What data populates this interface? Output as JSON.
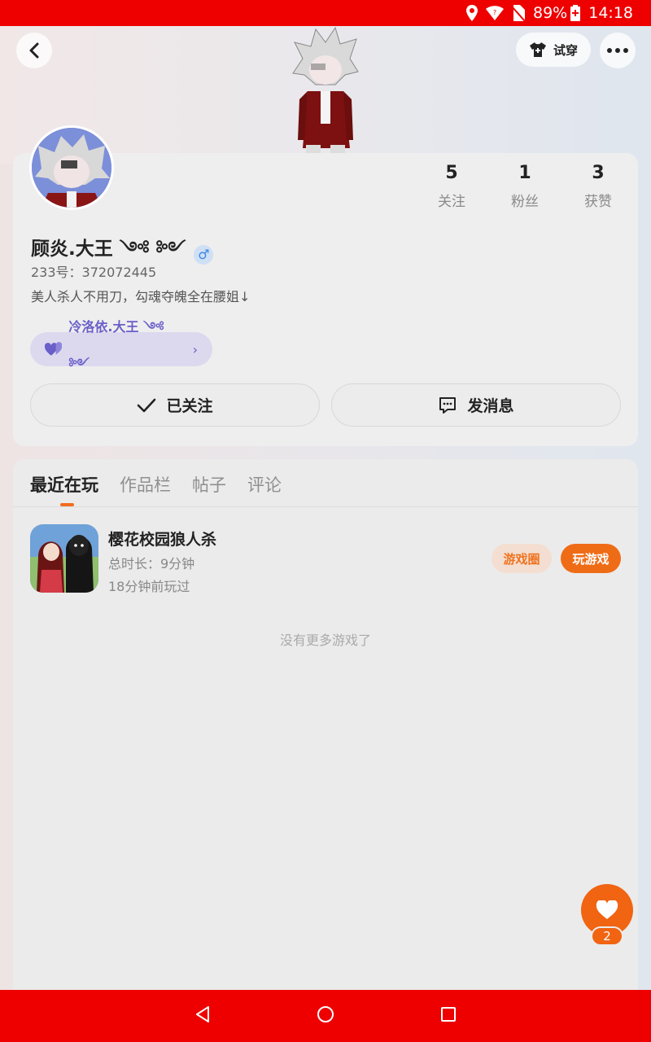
{
  "status_bar": {
    "battery": "89%",
    "time": "14:18"
  },
  "header": {
    "try_on_label": "试穿"
  },
  "profile": {
    "username": "顾炎.大王 ༺ ༻",
    "gender_symbol": "♂",
    "uid": "233号：372072445",
    "bio": "美人杀人不用刀，勾魂夺魄全在腰姐↓",
    "stats": [
      {
        "value": "5",
        "label": "关注"
      },
      {
        "value": "1",
        "label": "粉丝"
      },
      {
        "value": "3",
        "label": "获赞"
      }
    ],
    "cp_tag": {
      "name": "冷洛依.大王 ༺ ༻",
      "chevron": "›"
    },
    "follow_button": "已关注",
    "message_button": "发消息"
  },
  "tabs": [
    {
      "label": "最近在玩",
      "active": true
    },
    {
      "label": "作品栏",
      "active": false
    },
    {
      "label": "帖子",
      "active": false
    },
    {
      "label": "评论",
      "active": false
    }
  ],
  "games": [
    {
      "title": "樱花校园狼人杀",
      "duration": "总时长：9分钟",
      "last_played": "18分钟前玩过",
      "circle_button": "游戏圈",
      "play_button": "玩游戏"
    }
  ],
  "empty_hint": "没有更多游戏了",
  "like_count": "2",
  "colors": {
    "accent": "#f06d1f",
    "status_bar": "#ee0000",
    "cp_purple": "#6a5fc8"
  }
}
